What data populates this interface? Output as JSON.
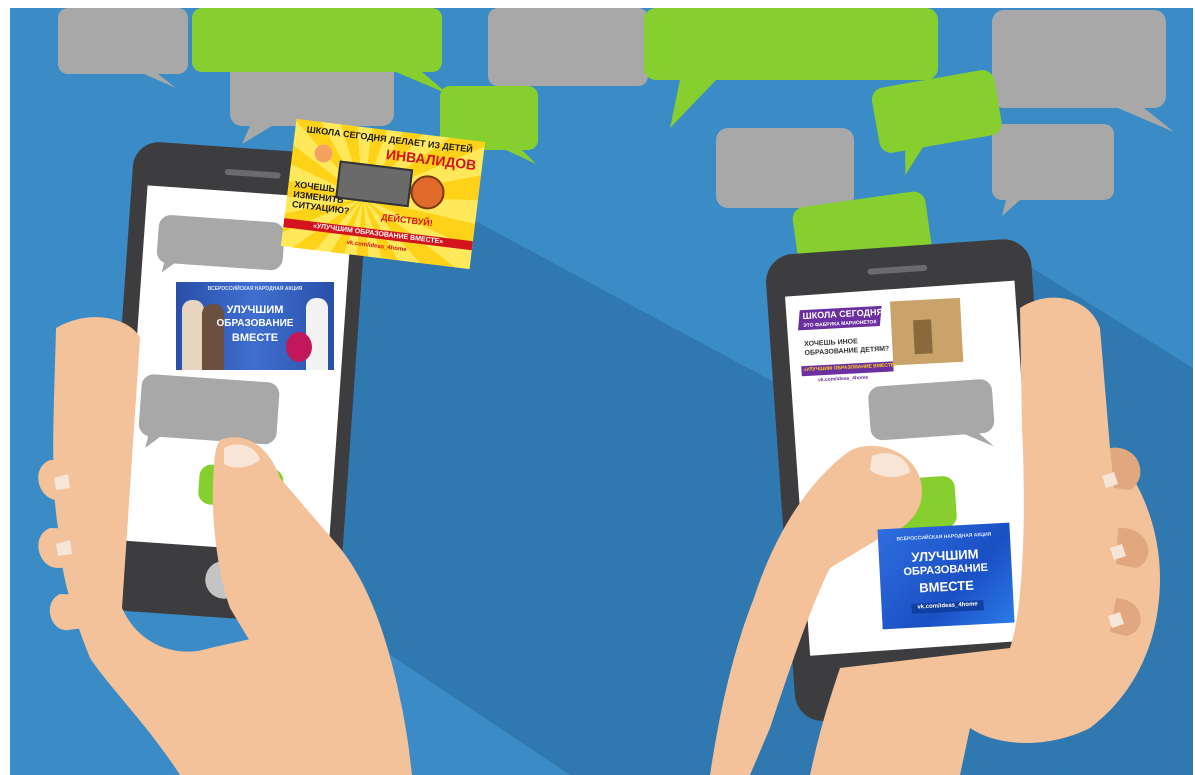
{
  "colors": {
    "background": "#3b8cc6",
    "shadow": "#2f78b0",
    "bubble_gray": "#a8a8a8",
    "bubble_green": "#86cf2e",
    "phone_body": "#3d3d40",
    "skin": "#f3c29b",
    "skin_shadow": "#e1a77f"
  },
  "ad_yellow": {
    "line1": "ШКОЛА СЕГОДНЯ ДЕЛАЕТ ИЗ ДЕТЕЙ",
    "line2": "ИНВАЛИДОВ",
    "line3": "ХОЧЕШЬ",
    "line4": "ИЗМЕНИТЬ",
    "line5": "СИТУАЦИЮ?",
    "line6": "ДЕЙСТВУЙ!",
    "slogan": "«УЛУЧШИМ ОБРАЗОВАНИЕ ВМЕСТЕ»",
    "url": "vk.com/ideas_4home"
  },
  "ad_children": {
    "kicker": "ВСЕРОССИЙСКАЯ НАРОДНАЯ АКЦИЯ",
    "line1": "УЛУЧШИМ",
    "line2": "ОБРАЗОВАНИЕ",
    "line3": "ВМЕСТЕ"
  },
  "ad_puppets": {
    "line1": "ШКОЛА СЕГОДНЯ",
    "line2": "ЭТО ФАБРИКА МАРИОНЕТОК",
    "line3": "ХОЧЕШЬ ИНОЕ",
    "line4": "ОБРАЗОВАНИЕ ДЕТЯМ?",
    "slogan": "«УЛУЧШИМ ОБРАЗОВАНИЕ ВМЕСТЕ»",
    "url": "vk.com/ideas_4home"
  },
  "ad_blue": {
    "kicker": "ВСЕРОССИЙСКАЯ НАРОДНАЯ АКЦИЯ",
    "line1": "УЛУЧШИМ",
    "line2": "ОБРАЗОВАНИЕ",
    "line3": "ВМЕСТЕ",
    "url": "vk.com/ideas_4home"
  }
}
